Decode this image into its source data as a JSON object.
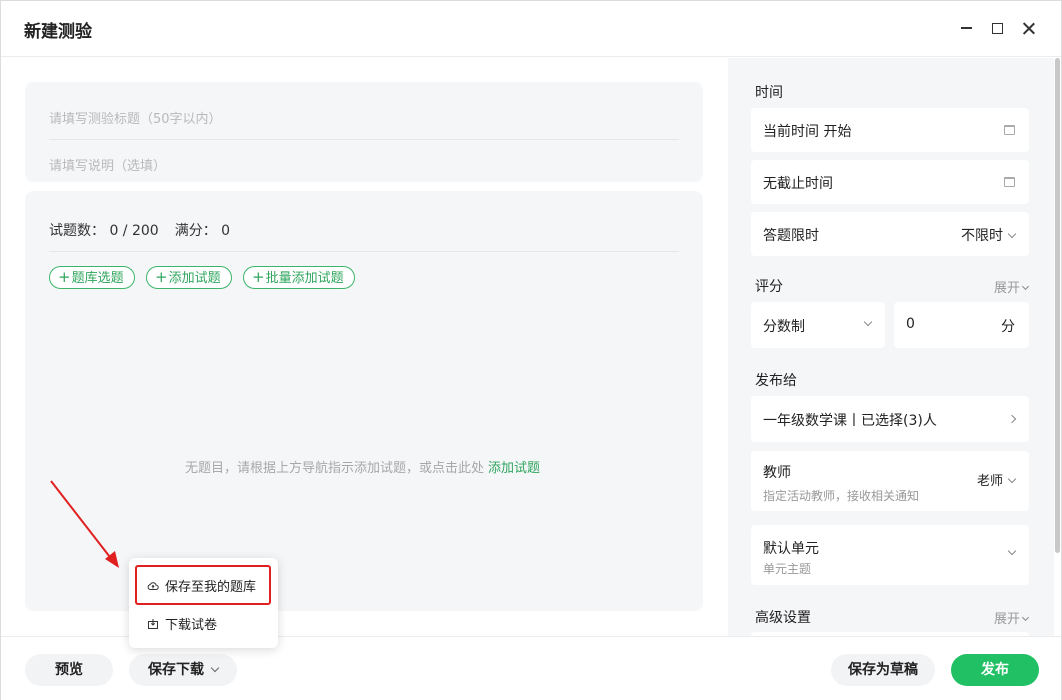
{
  "window": {
    "title": "新建测验"
  },
  "form": {
    "title_placeholder": "请填写测验标题（50字以内）",
    "desc_placeholder": "请填写说明（选填）"
  },
  "stats": {
    "count_label": "试题数：",
    "count_value": "0 / 200",
    "score_label": "满分：",
    "score_value": "0"
  },
  "actions": {
    "bank_label": "题库选题",
    "add_label": "添加试题",
    "batch_label": "批量添加试题",
    "plus": "+"
  },
  "empty": {
    "text": "无题目，请根据上方导航指示添加试题，或点击此处",
    "link": "添加试题"
  },
  "bottom": {
    "preview": "预览",
    "save_download": "保存下载",
    "save_draft": "保存为草稿",
    "publish": "发布"
  },
  "dropdown": {
    "items": [
      {
        "label": "保存至我的题库",
        "icon": "cloud-upload-icon"
      },
      {
        "label": "下载试卷",
        "icon": "download-icon"
      }
    ]
  },
  "settings": {
    "time": {
      "label": "时间",
      "start": "当前时间 开始",
      "end": "无截止时间",
      "limit_label": "答题限时",
      "limit_value": "不限时"
    },
    "score": {
      "label": "评分",
      "expand": "展开",
      "system": "分数制",
      "value": "0",
      "unit": "分"
    },
    "publish": {
      "label": "发布给",
      "target": "一年级数学课丨已选择(3)人",
      "teacher_label": "教师",
      "teacher_sub": "指定活动教师，接收相关通知",
      "teacher_value": "老师",
      "unit_label": "默认单元",
      "unit_sub": "单元主题"
    },
    "advanced": {
      "label": "高级设置",
      "expand": "展开"
    }
  },
  "colors": {
    "accent": "#21c064",
    "highlight": "#e02020",
    "panel_bg": "#f5f6f8"
  }
}
